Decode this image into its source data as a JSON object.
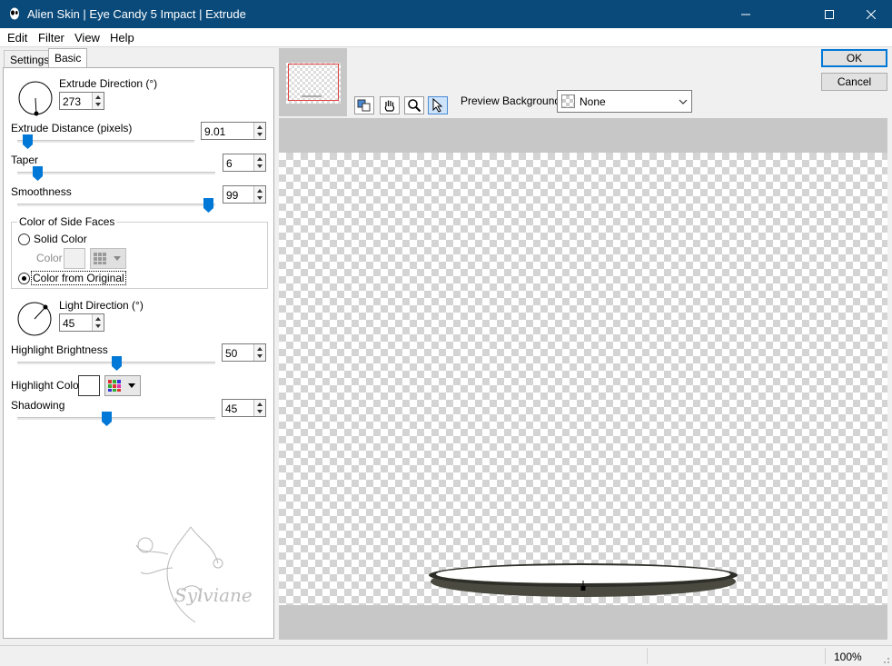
{
  "window": {
    "title": "Alien Skin | Eye Candy 5 Impact | Extrude"
  },
  "menu": [
    "Edit",
    "Filter",
    "View",
    "Help"
  ],
  "tabs": [
    "Settings",
    "Basic"
  ],
  "basic": {
    "extrude_direction": {
      "label": "Extrude Direction (°)",
      "value": "273"
    },
    "extrude_distance": {
      "label": "Extrude Distance (pixels)",
      "value": "9.01",
      "level": 0.03
    },
    "taper": {
      "label": "Taper",
      "value": "6",
      "level": 0.08
    },
    "smoothness": {
      "label": "Smoothness",
      "value": "99",
      "level": 0.99
    },
    "side_faces": {
      "label": "Color of Side Faces",
      "solid_color": "Solid Color",
      "color_label": "Color",
      "from_original": "Color from Original",
      "selected": "from_original"
    },
    "light_direction": {
      "label": "Light Direction (°)",
      "value": "45"
    },
    "highlight_brightness": {
      "label": "Highlight Brightness",
      "value": "50",
      "level": 0.5
    },
    "highlight_color": {
      "label": "Highlight Color",
      "color": "#ffffff"
    },
    "shadowing": {
      "label": "Shadowing",
      "value": "45",
      "level": 0.45
    }
  },
  "preview": {
    "background_label": "Preview Background:",
    "background_value": "None"
  },
  "buttons": {
    "ok": "OK",
    "cancel": "Cancel"
  },
  "status": {
    "zoom": "100%"
  },
  "watermark": {
    "text": "Sylviane"
  },
  "colors": {
    "titlebar": "#0a4a7a",
    "accent": "#0078d7"
  }
}
